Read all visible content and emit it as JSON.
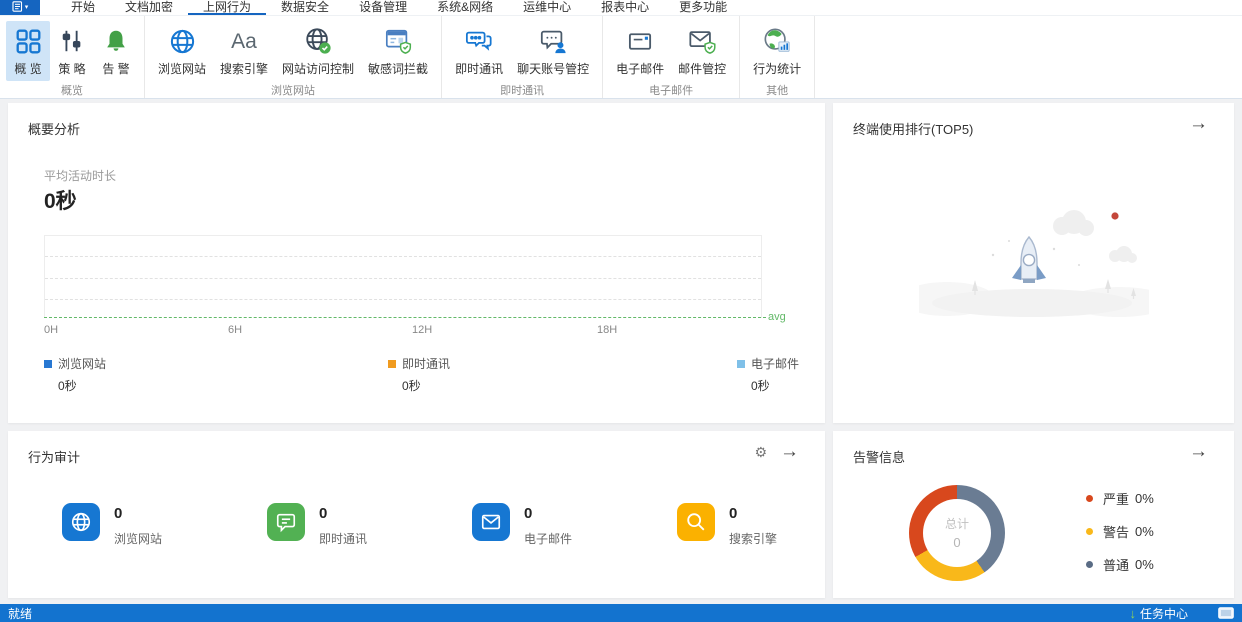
{
  "menubar": {
    "tabs": [
      {
        "label": "开始"
      },
      {
        "label": "文档加密"
      },
      {
        "label": "上网行为",
        "active": true
      },
      {
        "label": "数据安全"
      },
      {
        "label": "设备管理"
      },
      {
        "label": "系统&网络"
      },
      {
        "label": "运维中心"
      },
      {
        "label": "报表中心"
      },
      {
        "label": "更多功能"
      }
    ]
  },
  "ribbon": {
    "groups": [
      {
        "label": "概览",
        "items": [
          {
            "label": "概 览",
            "icon": "grid-icon",
            "selected": true
          },
          {
            "label": "策 略",
            "icon": "sliders-icon"
          },
          {
            "label": "告 警",
            "icon": "bell-icon"
          }
        ]
      },
      {
        "label": "浏览网站",
        "items": [
          {
            "label": "浏览网站",
            "icon": "globe-icon"
          },
          {
            "label": "搜索引擎",
            "icon": "aa-icon",
            "glyph": "Aa"
          },
          {
            "label": "网站访问控制",
            "icon": "globe-check-icon"
          },
          {
            "label": "敏感词拦截",
            "icon": "window-shield-icon"
          }
        ]
      },
      {
        "label": "即时通讯",
        "items": [
          {
            "label": "即时通讯",
            "icon": "chat-icon"
          },
          {
            "label": "聊天账号管控",
            "icon": "chat-user-icon"
          }
        ]
      },
      {
        "label": "电子邮件",
        "items": [
          {
            "label": "电子邮件",
            "icon": "mail-icon"
          },
          {
            "label": "邮件管控",
            "icon": "mail-shield-icon"
          }
        ]
      },
      {
        "label": "其他",
        "items": [
          {
            "label": "行为统计",
            "icon": "globe-chart-icon"
          }
        ]
      }
    ]
  },
  "summary_card": {
    "title": "概要分析",
    "metric_label": "平均活动时长",
    "metric_value": "0秒",
    "x_ticks": [
      "0H",
      "6H",
      "12H",
      "18H"
    ],
    "avg_label": "avg",
    "legend": [
      {
        "label": "浏览网站",
        "value": "0秒",
        "color": "#2878d2"
      },
      {
        "label": "即时通讯",
        "value": "0秒",
        "color": "#f09b1f"
      },
      {
        "label": "电子邮件",
        "value": "0秒",
        "color": "#7fc0e8"
      }
    ]
  },
  "ranking_card": {
    "title": "终端使用排行(TOP5)"
  },
  "audit_card": {
    "title": "行为审计",
    "items": [
      {
        "value": "0",
        "label": "浏览网站",
        "icon": "globe-icon",
        "color": "#1677d2"
      },
      {
        "value": "0",
        "label": "即时通讯",
        "icon": "chat-icon",
        "color": "#52b153"
      },
      {
        "value": "0",
        "label": "电子邮件",
        "icon": "mail-icon",
        "color": "#1677d2"
      },
      {
        "value": "0",
        "label": "搜索引擎",
        "icon": "search-icon",
        "color": "#fbb100"
      }
    ]
  },
  "alert_card": {
    "title": "告警信息",
    "center_label": "总计",
    "center_value": "0",
    "legend": [
      {
        "label": "严重",
        "value": "0%",
        "color": "#d8481d"
      },
      {
        "label": "警告",
        "value": "0%",
        "color": "#f9b81a"
      },
      {
        "label": "普通",
        "value": "0%",
        "color": "#5a6c85"
      }
    ]
  },
  "statusbar": {
    "left": "就绪",
    "task_center": "任务中心"
  },
  "chart_data": [
    {
      "type": "line",
      "title": "平均活动时长",
      "xlabel": "",
      "ylabel": "",
      "x_ticks": [
        "0H",
        "6H",
        "12H",
        "18H"
      ],
      "x_range": [
        "0H",
        "24H"
      ],
      "grid": true,
      "legend_position": "bottom",
      "series": [
        {
          "name": "浏览网站",
          "color": "#2878d2",
          "values": [
            0,
            0,
            0,
            0
          ],
          "total": "0秒"
        },
        {
          "name": "即时通讯",
          "color": "#f09b1f",
          "values": [
            0,
            0,
            0,
            0
          ],
          "total": "0秒"
        },
        {
          "name": "电子邮件",
          "color": "#7fc0e8",
          "values": [
            0,
            0,
            0,
            0
          ],
          "total": "0秒"
        }
      ],
      "avg_line": {
        "label": "avg",
        "value": 0,
        "color": "#63b969"
      }
    },
    {
      "type": "pie",
      "title": "告警信息",
      "center_label": "总计",
      "center_value": 0,
      "categories": [
        "严重",
        "警告",
        "普通"
      ],
      "values": [
        0,
        0,
        0
      ],
      "percent_labels": [
        "0%",
        "0%",
        "0%"
      ],
      "colors": [
        "#d8481d",
        "#f9b81a",
        "#6a7c93"
      ],
      "segment_angles_deg": [
        {
          "name": "普通",
          "start": 0,
          "end": 145
        },
        {
          "name": "警告",
          "start": 145,
          "end": 240
        },
        {
          "name": "严重",
          "start": 240,
          "end": 360
        }
      ]
    }
  ]
}
